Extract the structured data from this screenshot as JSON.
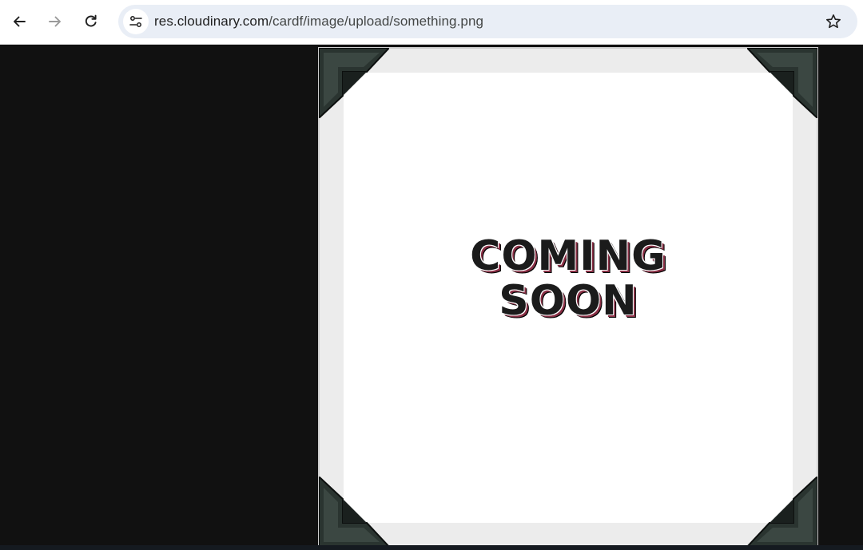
{
  "browser": {
    "url_host": "res.cloudinary.com",
    "url_path": "/cardf/image/upload/something.png",
    "icons": {
      "back": "arrow-left-icon",
      "forward": "arrow-right-icon",
      "reload": "reload-icon",
      "site_info": "tune-icon",
      "bookmark": "star-icon"
    }
  },
  "image": {
    "line1": "COMING",
    "line2": "SOON"
  },
  "colors": {
    "page_background": "#111111",
    "omnibox": "#e9eef6",
    "corner_mount": "#27322e"
  }
}
